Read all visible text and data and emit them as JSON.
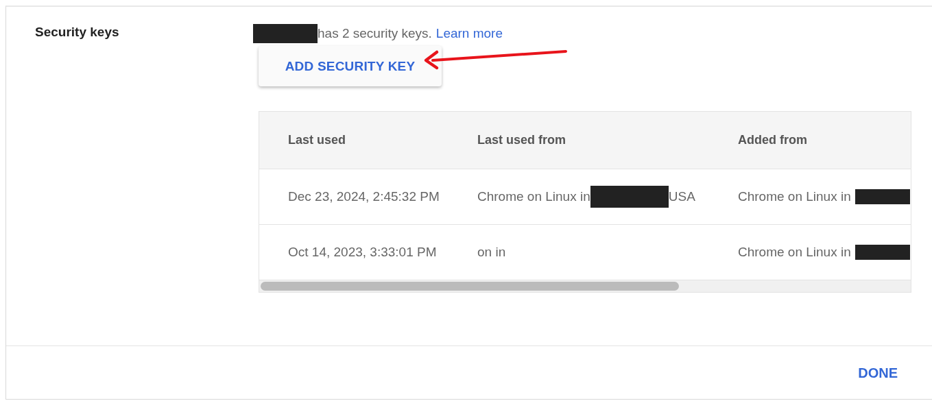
{
  "section": {
    "label": "Security keys"
  },
  "summary": {
    "owner_redacted": true,
    "text": "has 2 security keys.",
    "link": "Learn more"
  },
  "add_button": {
    "label": "ADD SECURITY KEY"
  },
  "annotation": {
    "kind": "arrow"
  },
  "table": {
    "columns": [
      "Last used",
      "Last used from",
      "Added from"
    ],
    "rows": [
      [
        {
          "text": "Dec 23, 2024, 2:45:32 PM",
          "redacted": false
        },
        {
          "text": "Chrome on Linux in",
          "redacted": true,
          "suffix": "USA"
        },
        {
          "text": "Chrome on Linux in",
          "redacted": true
        }
      ],
      [
        {
          "text": "Oct 14, 2023, 3:33:01 PM",
          "redacted": false
        },
        {
          "text": "on in",
          "redacted": false
        },
        {
          "text": "Chrome on Linux in",
          "redacted": true
        }
      ]
    ]
  },
  "footer": {
    "button": "DONE"
  }
}
